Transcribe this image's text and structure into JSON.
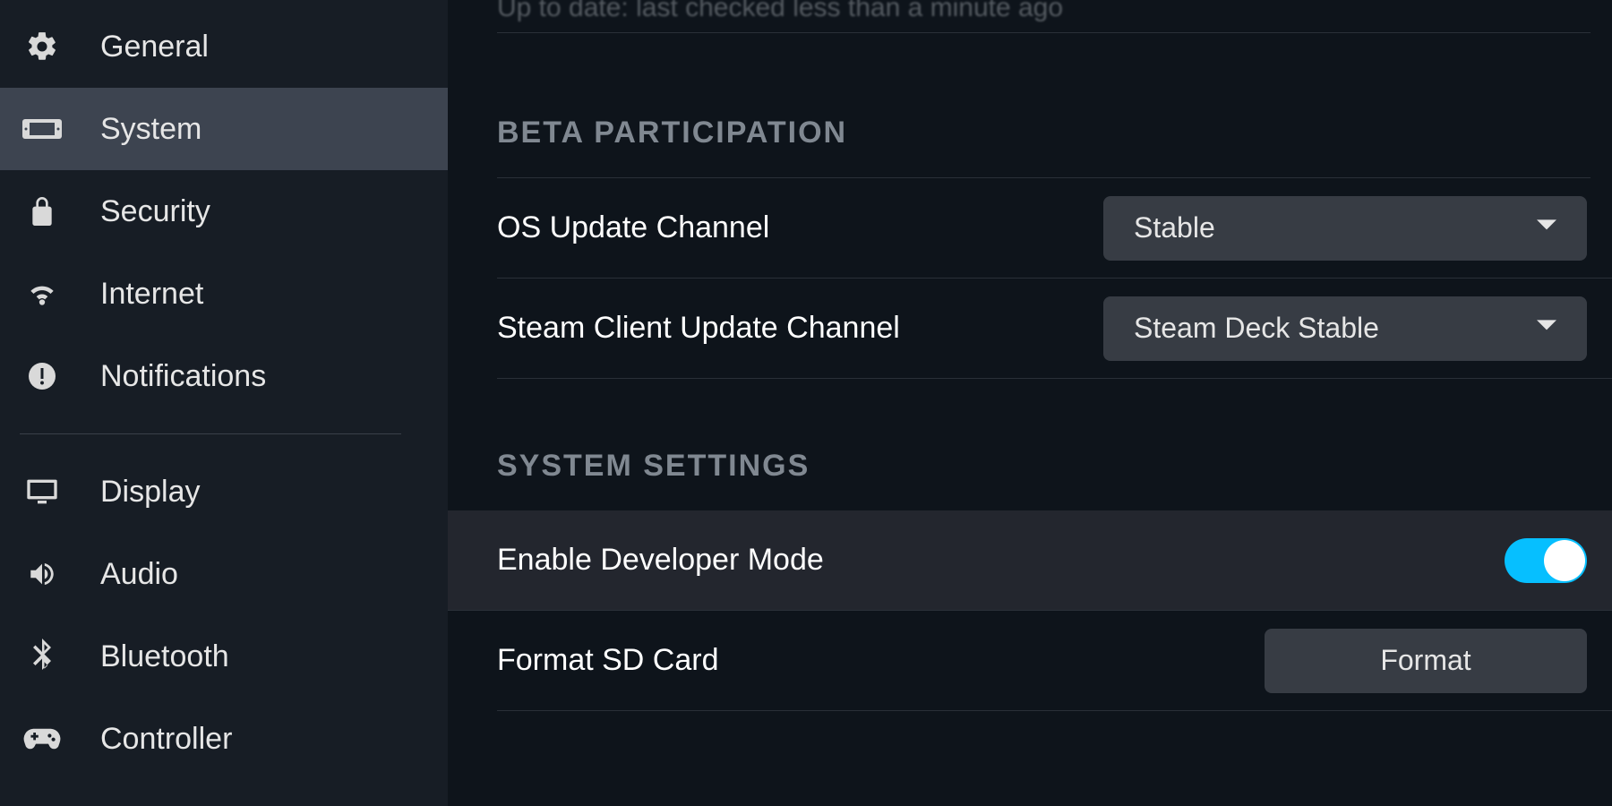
{
  "sidebar": {
    "group1": [
      {
        "id": "general",
        "label": "General"
      },
      {
        "id": "system",
        "label": "System"
      },
      {
        "id": "security",
        "label": "Security"
      },
      {
        "id": "internet",
        "label": "Internet"
      },
      {
        "id": "notifications",
        "label": "Notifications"
      }
    ],
    "group2": [
      {
        "id": "display",
        "label": "Display"
      },
      {
        "id": "audio",
        "label": "Audio"
      },
      {
        "id": "bluetooth",
        "label": "Bluetooth"
      },
      {
        "id": "controller",
        "label": "Controller"
      }
    ],
    "active": "system"
  },
  "main": {
    "status_line": "Up to date: last checked less than a minute ago",
    "sections": {
      "beta": {
        "header": "BETA PARTICIPATION",
        "os_channel": {
          "label": "OS Update Channel",
          "value": "Stable"
        },
        "client_channel": {
          "label": "Steam Client Update Channel",
          "value": "Steam Deck Stable"
        }
      },
      "system_settings": {
        "header": "SYSTEM SETTINGS",
        "dev_mode": {
          "label": "Enable Developer Mode",
          "enabled": true
        },
        "format_sd": {
          "label": "Format SD Card",
          "button": "Format"
        }
      }
    }
  },
  "colors": {
    "accent": "#06bfff",
    "panel": "#373c44",
    "bg": "#0e141b",
    "sidebar": "#171d25"
  }
}
